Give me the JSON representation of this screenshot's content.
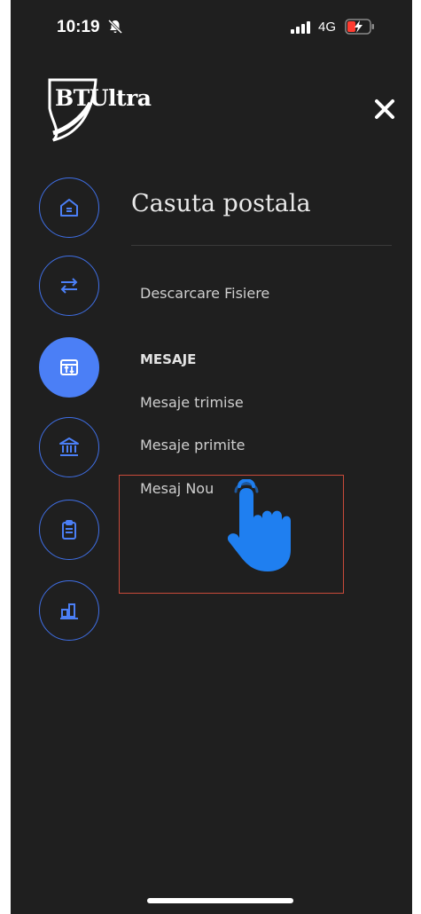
{
  "status_bar": {
    "time": "10:19",
    "network": "4G",
    "icons": [
      "bell-slash-icon",
      "signal-icon",
      "battery-charging-icon"
    ]
  },
  "header": {
    "logo_text": "BTUltra",
    "close_icon": "close-icon"
  },
  "nav": {
    "items": [
      {
        "icon": "home-icon",
        "active": false
      },
      {
        "icon": "transfer-icon",
        "active": false
      },
      {
        "icon": "mailbox-icon",
        "active": true
      },
      {
        "icon": "bank-icon",
        "active": false
      },
      {
        "icon": "clipboard-icon",
        "active": false
      },
      {
        "icon": "chart-icon",
        "active": false
      }
    ]
  },
  "content": {
    "title": "Casuta postala",
    "items": [
      {
        "label": "Descarcare Fisiere"
      },
      {
        "label": "MESAJE"
      },
      {
        "label": "Mesaje trimise"
      },
      {
        "label": "Mesaje primite"
      },
      {
        "label": "Mesaj Nou"
      }
    ]
  },
  "colors": {
    "background": "#1f1f1f",
    "accent": "#4b7ff6",
    "highlight": "#c94a3a",
    "hand": "#1f7ff0"
  }
}
